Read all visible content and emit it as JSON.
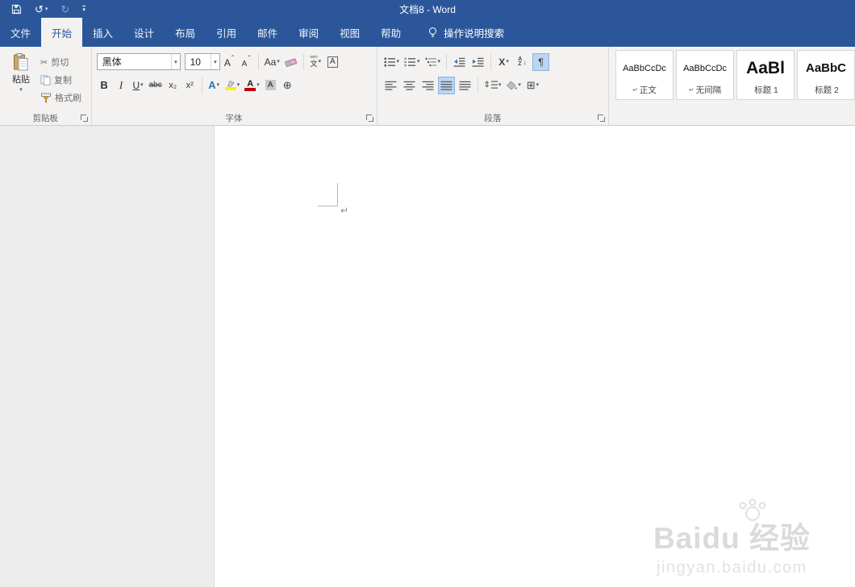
{
  "title_bar": {
    "title": "文档8 - Word"
  },
  "tabs": [
    {
      "label": "文件"
    },
    {
      "label": "开始"
    },
    {
      "label": "插入"
    },
    {
      "label": "设计"
    },
    {
      "label": "布局"
    },
    {
      "label": "引用"
    },
    {
      "label": "邮件"
    },
    {
      "label": "审阅"
    },
    {
      "label": "视图"
    },
    {
      "label": "帮助"
    }
  ],
  "search_label": "操作说明搜索",
  "clipboard": {
    "label": "剪贴板",
    "paste": "粘贴",
    "cut": "剪切",
    "copy": "复制",
    "format_painter": "格式刷"
  },
  "font": {
    "label": "字体",
    "name": "黑体",
    "size": "10"
  },
  "paragraph": {
    "label": "段落"
  },
  "styles": [
    {
      "preview": "AaBbCcDc",
      "prefix": "↵",
      "name": "正文"
    },
    {
      "preview": "AaBbCcDc",
      "prefix": "↵",
      "name": "无间隔"
    },
    {
      "preview": "AaBl",
      "prefix": "",
      "name": "标题 1"
    },
    {
      "preview": "AaBbC",
      "prefix": "",
      "name": "标题 2"
    }
  ],
  "glyphs": {
    "caret": "▾",
    "undo": "↺",
    "redo": "↻",
    "scissors": "✂",
    "grow": "A",
    "grow_mark": "ˆ",
    "shrink": "A",
    "shrink_mark": "ˇ",
    "case": "Aa",
    "bold": "B",
    "italic": "I",
    "underline": "U",
    "strike": "abc",
    "subscript": "x₂",
    "superscript": "x²",
    "effects": "A",
    "char_border": "A",
    "pinyin_top": "wén",
    "pinyin_bottom": "文",
    "font_color_letter": "A",
    "shading_letter": "A",
    "enclose": "⊕",
    "asian": "X",
    "sort_a": "A",
    "sort_z": "Z",
    "sort_arrow": "↓",
    "pilcrow_toggle": "¶",
    "line_spacing": "⇕",
    "borders": "⊞"
  },
  "document": {
    "pilcrow": "↵"
  },
  "watermark": {
    "brand": "Baidu",
    "suffix": " 经验",
    "url": "jingyan.baidu.com"
  }
}
